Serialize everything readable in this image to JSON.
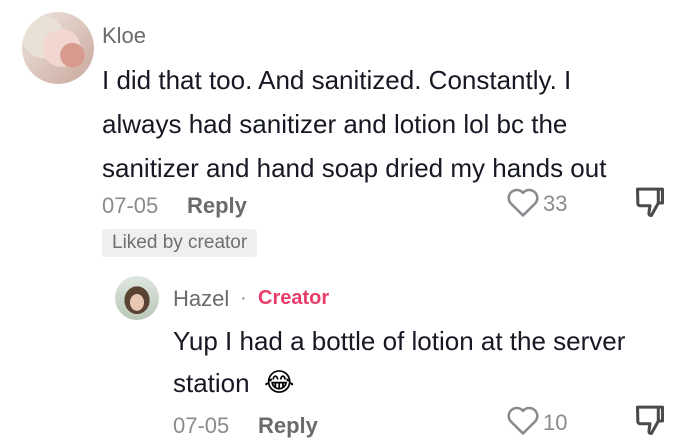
{
  "comment": {
    "author": "Kloe",
    "lines": [
      "I did that too. And sanitized. Constantly. I",
      "always had sanitizer and lotion lol bc the",
      "sanitizer and hand soap dried my hands out"
    ],
    "date": "07-05",
    "reply_label": "Reply",
    "like_count": "33",
    "liked_by_creator": "Liked by creator"
  },
  "reply": {
    "author": "Hazel",
    "separator": "·",
    "badge": "Creator",
    "lines": [
      "Yup I had a bottle of lotion at the server",
      "station"
    ],
    "emoji": "😂",
    "date": "07-05",
    "reply_label": "Reply",
    "like_count": "10"
  }
}
